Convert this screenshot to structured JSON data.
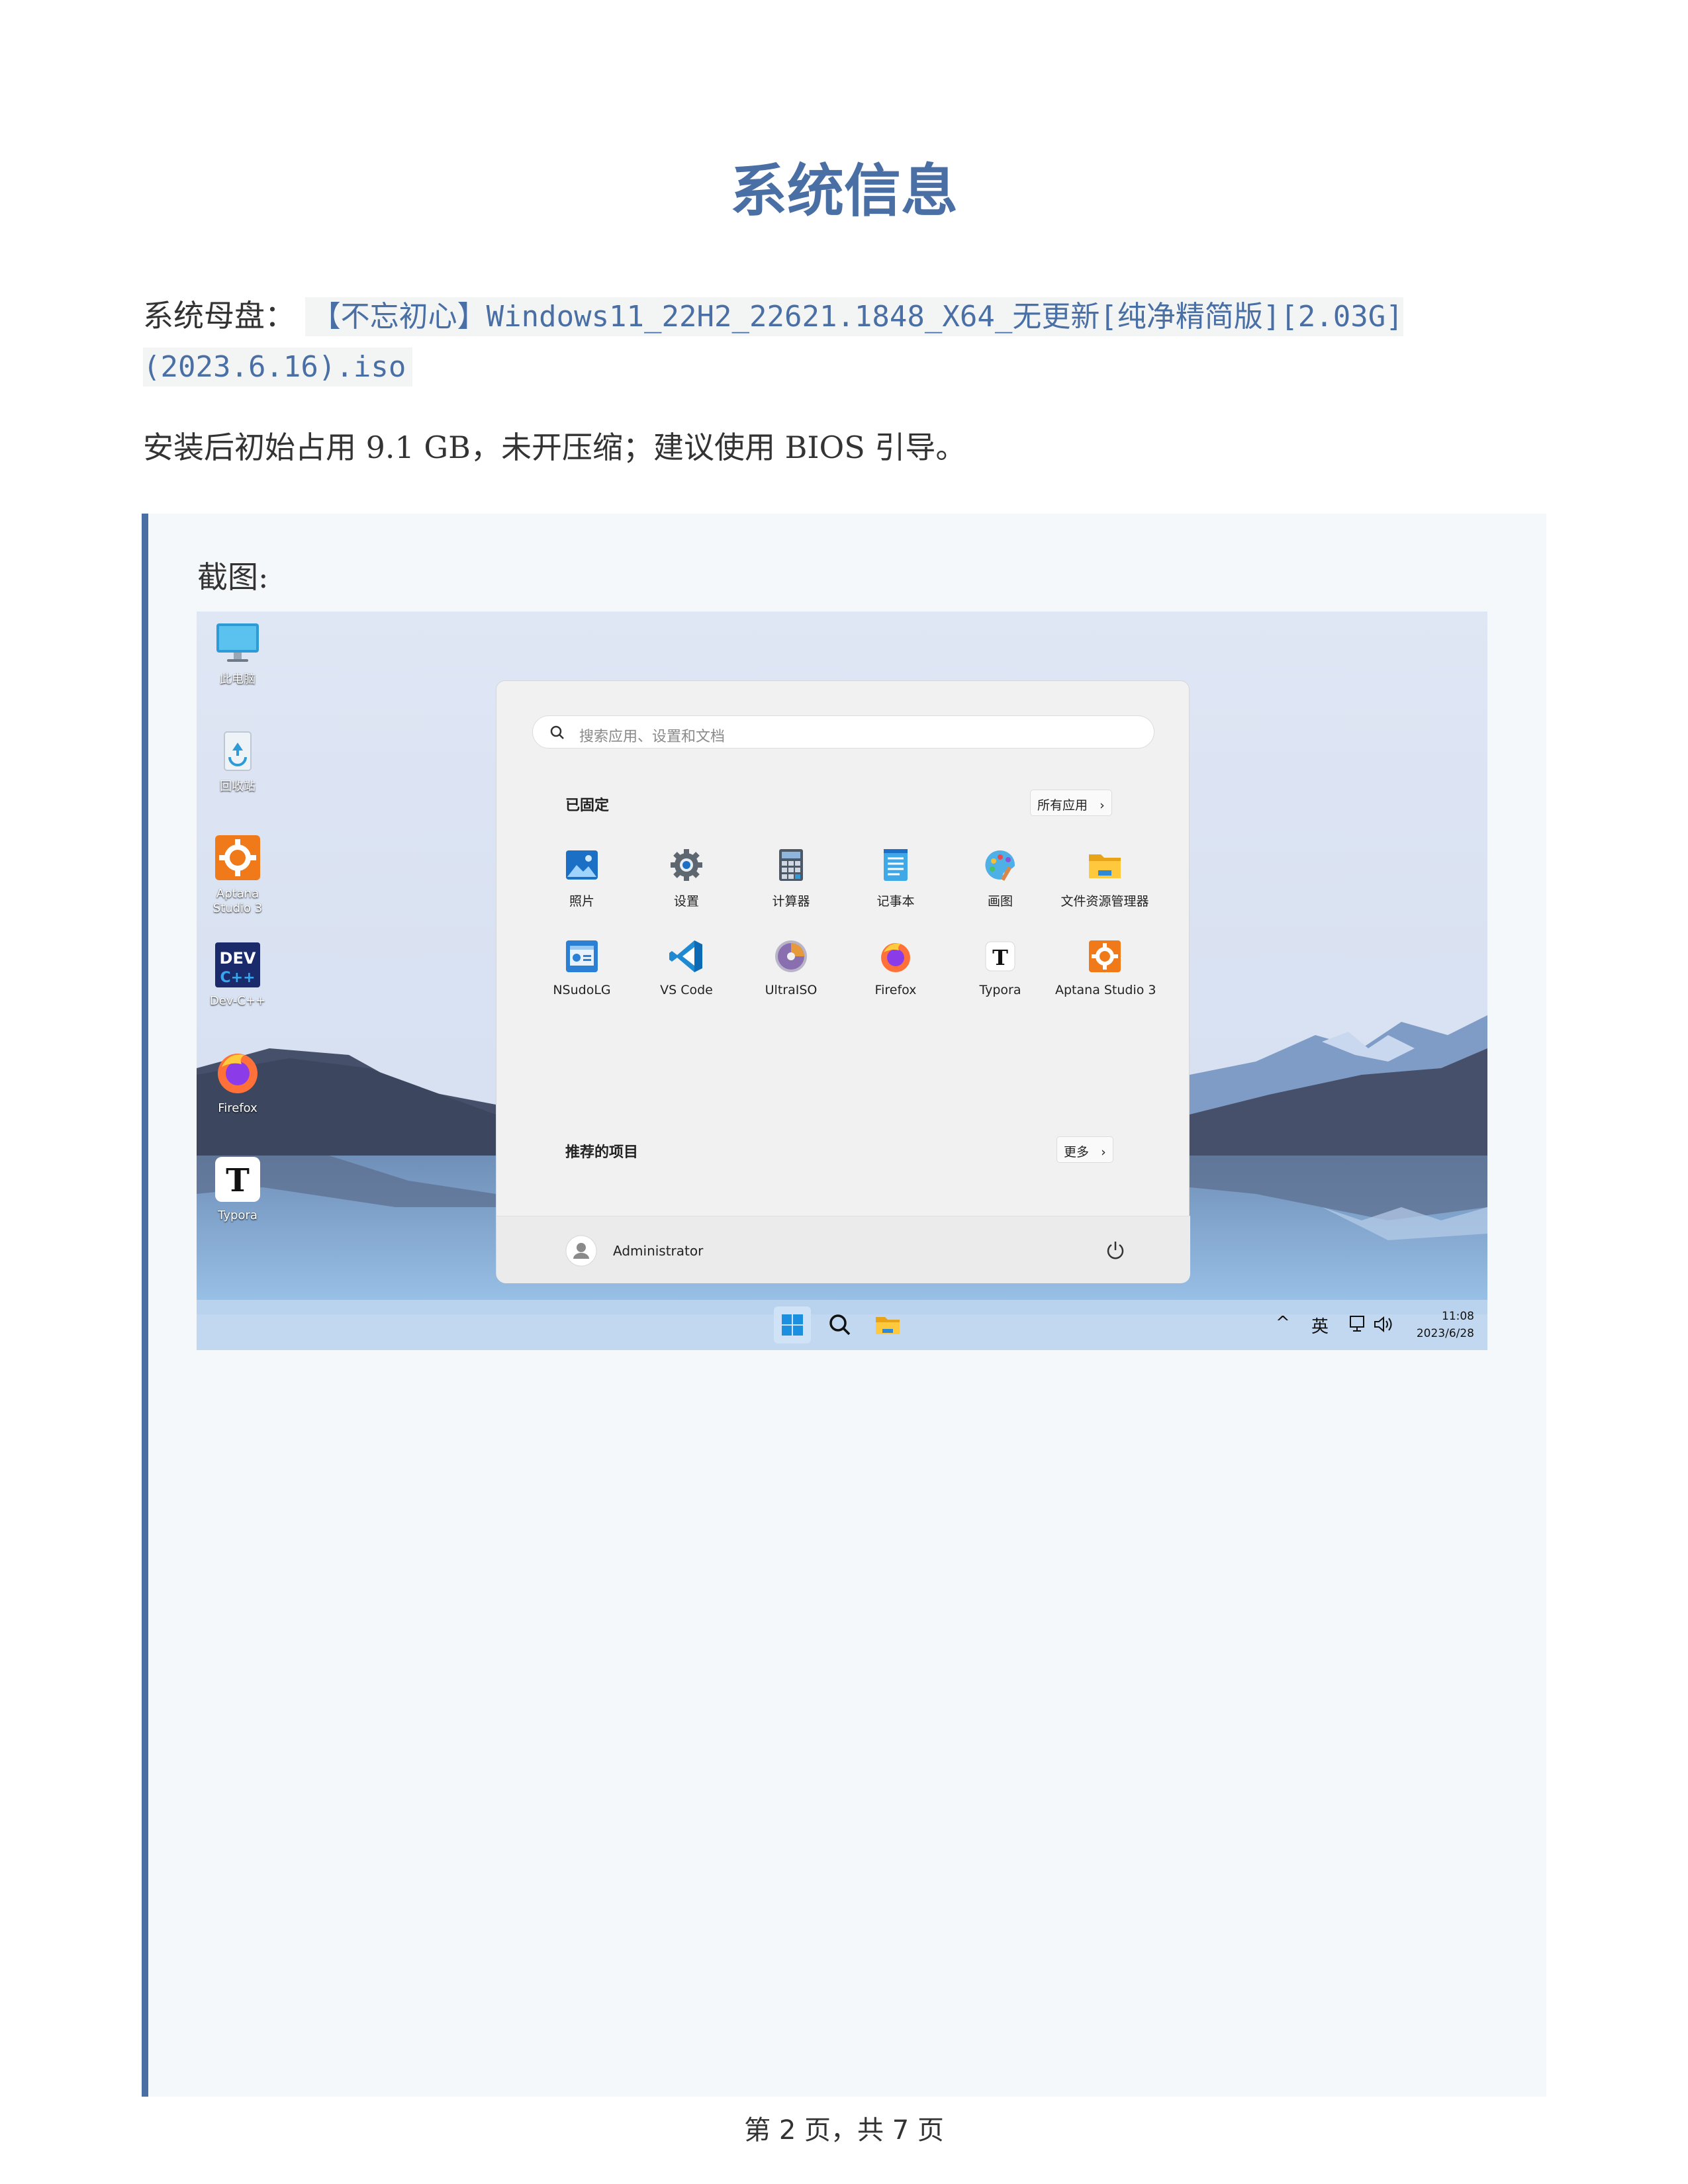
{
  "title": "系统信息",
  "paragraph1": {
    "label": "系统母盘：",
    "iso_name": "【不忘初心】Windows11_22H2_22621.1848_X64_无更新[纯净精简版][2.03G](2023.6.16).iso"
  },
  "paragraph2": "安装后初始占用 9.1 GB，未开压缩；建议使用 BIOS 引导。",
  "quote": {
    "label": "截图:"
  },
  "screenshot": {
    "desktop_icons": [
      {
        "label": "此电脑",
        "icon": "monitor-icon"
      },
      {
        "label": "回收站",
        "icon": "recycle-bin-icon"
      },
      {
        "label": "Aptana Studio 3",
        "icon": "aptana-icon"
      },
      {
        "label": "Dev-C++",
        "icon": "devcpp-icon"
      },
      {
        "label": "Firefox",
        "icon": "firefox-icon"
      },
      {
        "label": "Typora",
        "icon": "typora-icon"
      }
    ],
    "start_menu": {
      "search_placeholder": "搜索应用、设置和文档",
      "pinned_title": "已固定",
      "all_apps_label": "所有应用",
      "pinned_apps": [
        {
          "label": "照片",
          "icon": "photos-icon"
        },
        {
          "label": "设置",
          "icon": "settings-gear-icon"
        },
        {
          "label": "计算器",
          "icon": "calculator-icon"
        },
        {
          "label": "记事本",
          "icon": "notepad-icon"
        },
        {
          "label": "画图",
          "icon": "paint-icon"
        },
        {
          "label": "文件资源管理器",
          "icon": "file-explorer-icon"
        },
        {
          "label": "NSudoLG",
          "icon": "nsudo-icon"
        },
        {
          "label": "VS Code",
          "icon": "vscode-icon"
        },
        {
          "label": "UltraISO",
          "icon": "ultraiso-icon"
        },
        {
          "label": "Firefox",
          "icon": "firefox-icon"
        },
        {
          "label": "Typora",
          "icon": "typora-icon"
        },
        {
          "label": "Aptana Studio 3",
          "icon": "aptana-icon"
        }
      ],
      "recommended_title": "推荐的项目",
      "more_label": "更多",
      "user_name": "Administrator"
    },
    "taskbar": {
      "ime": "英",
      "time": "11:08",
      "date": "2023/6/28"
    }
  },
  "footer": "第 2 页，共 7 页",
  "colors": {
    "heading": "#4a6fa5",
    "quote_border": "#4a6fa5",
    "quote_bg": "#f5f8fb"
  }
}
